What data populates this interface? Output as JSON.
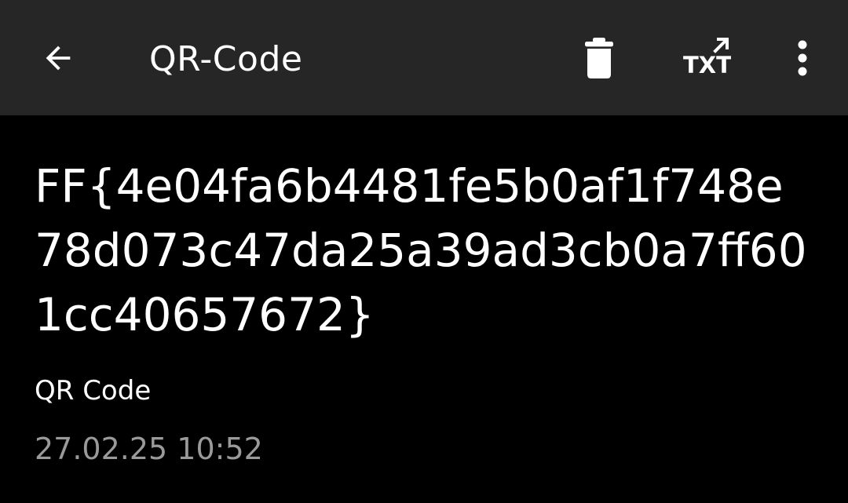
{
  "header": {
    "title": "QR-Code",
    "icons": {
      "back": "arrow-back-icon",
      "delete": "trash-icon",
      "export_txt": "txt-export-icon",
      "more": "more-vert-icon"
    },
    "export_icon_text": "TXT"
  },
  "result": {
    "text": "FF{4e04fa6b4481fe5b0af1f748e78d073c47da25a39ad3cb0a7ff601cc40657672}",
    "format": "QR Code",
    "timestamp": "27.02.25 10:52"
  },
  "colors": {
    "toolbar_bg": "#262626",
    "page_bg": "#000000",
    "text_primary": "#ffffff",
    "text_secondary": "#9a9a9a"
  }
}
